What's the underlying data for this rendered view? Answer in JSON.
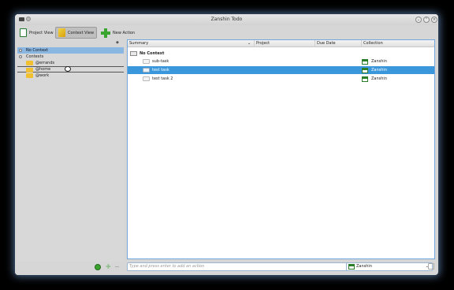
{
  "window": {
    "title": "Zanshin Todo"
  },
  "toolbar": {
    "project_view": "Project View",
    "context_view": "Context View",
    "new_action": "New Action"
  },
  "sidebar": {
    "items": [
      {
        "label": "No Context",
        "selected": true
      },
      {
        "label": "Contexts"
      },
      {
        "label": "@errands"
      },
      {
        "label": "@home"
      },
      {
        "label": "@work"
      }
    ]
  },
  "table": {
    "columns": [
      "Summary",
      "Project",
      "Due Date",
      "Collection"
    ],
    "group": "No Context",
    "rows": [
      {
        "summary": "sub-task",
        "project": "",
        "due": "",
        "collection": "Zanshin"
      },
      {
        "summary": "test task",
        "project": "",
        "due": "",
        "collection": "Zanshin",
        "selected": true
      },
      {
        "summary": "test task 2",
        "project": "",
        "due": "",
        "collection": "Zanshin"
      }
    ]
  },
  "bottombar": {
    "add_placeholder": "Type and press enter to add an action",
    "collection": "Zanshin"
  },
  "colors": {
    "selection": "#3b97dc",
    "accent_green": "#3aa52e"
  }
}
